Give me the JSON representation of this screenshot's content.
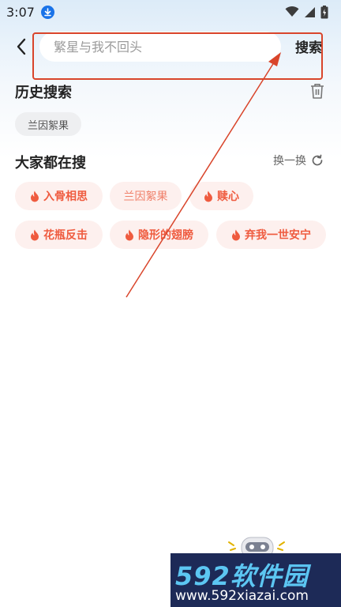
{
  "status_bar": {
    "time": "3:07",
    "icons": [
      "download-icon",
      "wifi-icon",
      "signal-icon",
      "battery-icon"
    ]
  },
  "header": {
    "back_icon": "chevron-left-icon",
    "search_placeholder": "繁星与我不回头",
    "search_value": "",
    "search_button": "搜索"
  },
  "history": {
    "title": "历史搜索",
    "clear_icon": "trash-icon",
    "items": [
      "兰因絮果"
    ]
  },
  "trending": {
    "title": "大家都在搜",
    "refresh_label": "换一换",
    "refresh_icon": "refresh-icon",
    "items": [
      {
        "label": "入骨相思",
        "hot": true
      },
      {
        "label": "兰因絮果",
        "hot": false
      },
      {
        "label": "赎心",
        "hot": true
      },
      {
        "label": "花瓶反击",
        "hot": true
      },
      {
        "label": "隐形的翅膀",
        "hot": true
      },
      {
        "label": "弃我一世安宁",
        "hot": true
      }
    ]
  },
  "watermark": {
    "brand": "592软件园",
    "url": "www.592xiazai.com"
  },
  "colors": {
    "accent_orange": "#ef5b3f",
    "chip_pink_bg": "#fdf0ee",
    "annotation_red": "#d9452b",
    "watermark_bg": "#1d2a57",
    "watermark_cyan": "#5cc6f2"
  }
}
